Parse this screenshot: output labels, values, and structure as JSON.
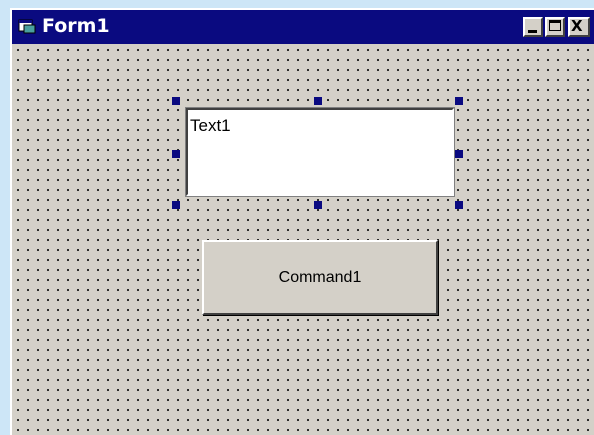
{
  "window": {
    "title": "Form1",
    "controls": {
      "minimize_icon": "minimize-icon",
      "maximize_icon": "maximize-icon",
      "close_label": "X"
    }
  },
  "form": {
    "textbox": {
      "value": "Text1",
      "selected": true
    },
    "command_button": {
      "label": "Command1"
    }
  },
  "colors": {
    "titlebar": "#0a0a80",
    "form_background": "#d4d0c8",
    "desktop": "#cde6f7",
    "selection_handle": "#0a0a80"
  }
}
